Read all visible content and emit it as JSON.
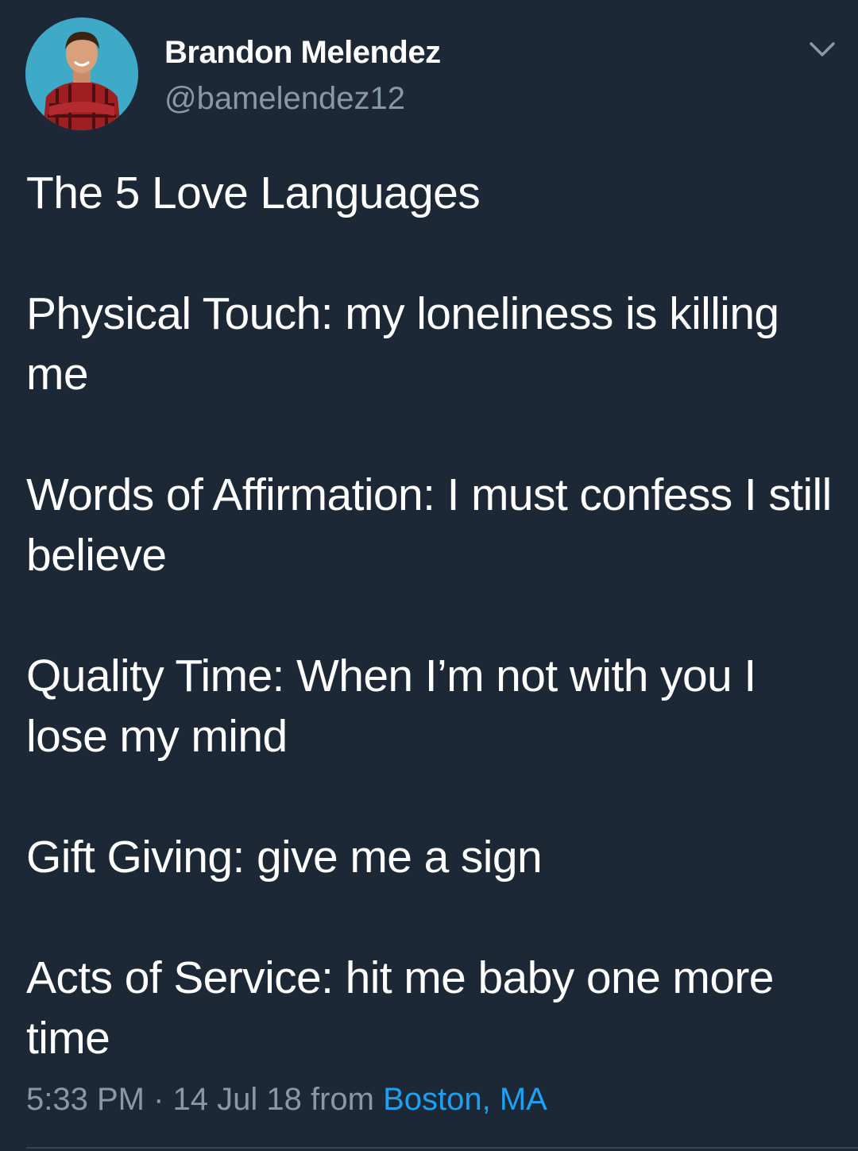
{
  "author": {
    "name": "Brandon Melendez",
    "handle": "@bamelendez12"
  },
  "tweet": {
    "paragraphs": [
      "The 5 Love Languages",
      "Physical Touch: my loneliness is killing me",
      "Words of Affirmation: I must confess I still believe",
      "Quality Time: When I’m not with you I lose my mind",
      "Gift Giving: give me a sign",
      "Acts of Service: hit me baby one more time"
    ]
  },
  "meta": {
    "time": "5:33 PM",
    "separator": " · ",
    "date": "14 Jul 18",
    "from_label": " from ",
    "location": "Boston, MA"
  },
  "icons": {
    "menu": "chevron-down-icon",
    "avatar": "avatar"
  },
  "colors": {
    "background": "#1c2836",
    "text_primary": "#ffffff",
    "text_secondary": "#8899a6",
    "link": "#1da1f2",
    "avatar_bg": "#3fa9c8"
  }
}
